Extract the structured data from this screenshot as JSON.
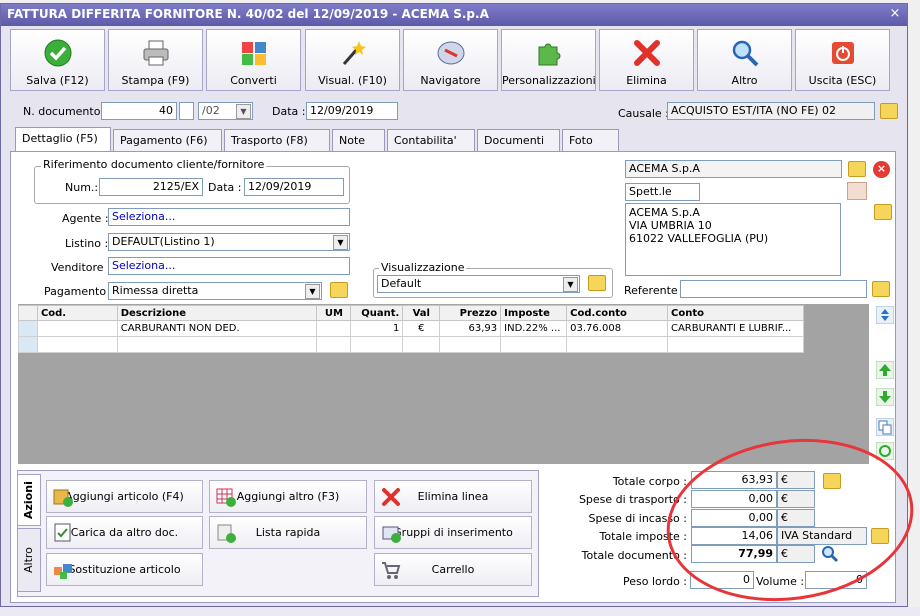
{
  "window": {
    "title": "FATTURA DIFFERITA FORNITORE N. 40/02 del 12/09/2019 - ACEMA S.p.A",
    "close_label": "×"
  },
  "toolbar": [
    {
      "label": "Salva (F12)",
      "icon": "check-icon"
    },
    {
      "label": "Stampa (F9)",
      "icon": "printer-icon"
    },
    {
      "label": "Converti",
      "icon": "convert-icon"
    },
    {
      "label": "Visual. (F10)",
      "icon": "magic-wand-icon"
    },
    {
      "label": "Navigatore",
      "icon": "compass-icon"
    },
    {
      "label": "Personalizzazioni",
      "icon": "puzzle-icon"
    },
    {
      "label": "Elimina",
      "icon": "delete-x-icon"
    },
    {
      "label": "Altro",
      "icon": "magnifier-icon"
    },
    {
      "label": "Uscita (ESC)",
      "icon": "power-icon"
    }
  ],
  "header": {
    "doc_label": "N. documento :",
    "doc_number": "40",
    "doc_suffix": "/02",
    "date_label": "Data :",
    "date": "12/09/2019",
    "causale_label": "Causale :",
    "causale": "ACQUISTO EST/ITA (NO FE) 02"
  },
  "tabs": [
    "Dettaglio (F5)",
    "Pagamento (F6)",
    "Trasporto (F8)",
    "Note",
    "Contabilita'",
    "Documenti",
    "Foto"
  ],
  "rif": {
    "legend": "Riferimento documento cliente/fornitore",
    "num_label": "Num.:",
    "num": "2125/EX",
    "data_label": "Data :",
    "data": "12/09/2019"
  },
  "fields": {
    "agente_label": "Agente :",
    "agente": "Seleziona...",
    "listino_label": "Listino :",
    "listino": "DEFAULT(Listino 1)",
    "venditore_label": "Venditore :",
    "venditore": "Seleziona...",
    "pagamento_label": "Pagamento :",
    "pagamento": "Rimessa diretta",
    "visual_legend": "Visualizzazione",
    "visual": "Default"
  },
  "supplier": {
    "name": "ACEMA S.p.A",
    "salutation": "Spett.le",
    "address_lines": [
      "ACEMA S.p.A",
      "VIA UMBRIA 10",
      "61022 VALLEFOGLIA (PU)"
    ],
    "referente_label": "Referente",
    "referente": ""
  },
  "grid": {
    "columns": [
      "Cod.",
      "Descrizione",
      "UM",
      "Quant.",
      "Val",
      "Prezzo",
      "Imposte",
      "Cod.conto",
      "Conto"
    ],
    "rows": [
      [
        "",
        "CARBURANTI NON DED.",
        "",
        "1",
        "€",
        "63,93",
        "IND.22% ...",
        "03.76.008",
        "CARBURANTI E LUBRIF..."
      ]
    ]
  },
  "side_tabs": [
    "Azioni",
    "Altro"
  ],
  "actions": [
    {
      "label": "Aggiungi articolo (F4)",
      "icon": "add-box-icon"
    },
    {
      "label": "Aggiungi altro (F3)",
      "icon": "add-grid-icon"
    },
    {
      "label": "Elimina linea",
      "icon": "delete-x-icon"
    },
    {
      "label": "Carica da altro doc.",
      "icon": "load-doc-icon"
    },
    {
      "label": "Lista rapida",
      "icon": "quick-list-icon"
    },
    {
      "label": "Gruppi di inserimento",
      "icon": "group-insert-icon"
    },
    {
      "label": "Sostituzione articolo",
      "icon": "replace-icon"
    },
    {
      "label": "",
      "icon": ""
    },
    {
      "label": "Carrello",
      "icon": "cart-icon"
    }
  ],
  "totals": {
    "corpo_label": "Totale corpo :",
    "corpo": "63,93",
    "trasporto_label": "Spese di trasporto :",
    "trasporto": "0,00",
    "incasso_label": "Spese di incasso :",
    "incasso": "0,00",
    "imposte_label": "Totale imposte :",
    "imposte": "14,06",
    "iva": "IVA Standard",
    "documento_label": "Totale documento :",
    "documento": "77,99",
    "currency": "€",
    "peso_label": "Peso lordo :",
    "peso": "0",
    "volume_label": "Volume :",
    "volume": "0"
  }
}
